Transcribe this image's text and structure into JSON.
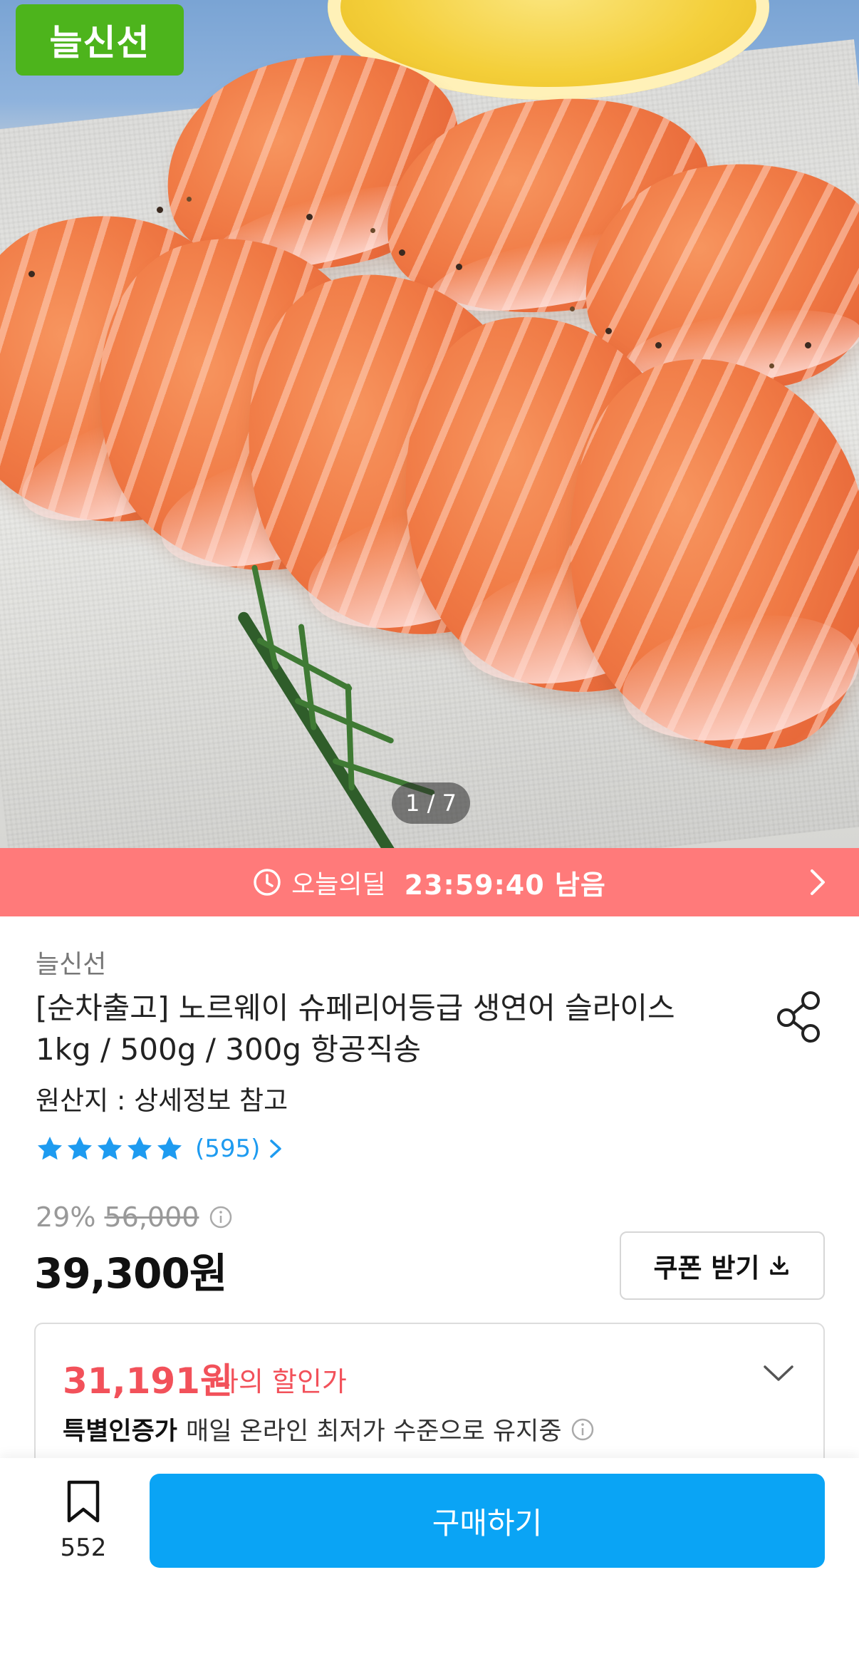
{
  "hero": {
    "seller_badge": "늘신선",
    "pager": "1 / 7"
  },
  "deal_banner": {
    "label": "오늘의딜",
    "timer": "23:59:40 남음",
    "icon": "clock-icon"
  },
  "product": {
    "brand": "늘신선",
    "title": "[순차출고] 노르웨이 슈페리어등급 생연어 슬라이스 1kg / 500g / 300g 항공직송",
    "origin": "원산지 : 상세정보 참고",
    "rating_stars": 5,
    "rating_count": "(595)",
    "discount_percent": "29%",
    "original_price": "56,000",
    "price": "39,300원",
    "coupon_label": "쿠폰 받기"
  },
  "my_price": {
    "amount": "31,191원",
    "label": "나의 할인가",
    "cert_bold": "특별인증가",
    "cert_text": "매일 온라인 최저가 수준으로 유지중"
  },
  "bottom_bar": {
    "bookmark_count": "552",
    "buy_label": "구매하기"
  },
  "colors": {
    "deal_banner": "#ff7a7a",
    "badge": "#4db41c",
    "accent_blue": "#0aa4f5",
    "discount_red": "#f2515a",
    "rating_blue": "#1e9bf0"
  }
}
